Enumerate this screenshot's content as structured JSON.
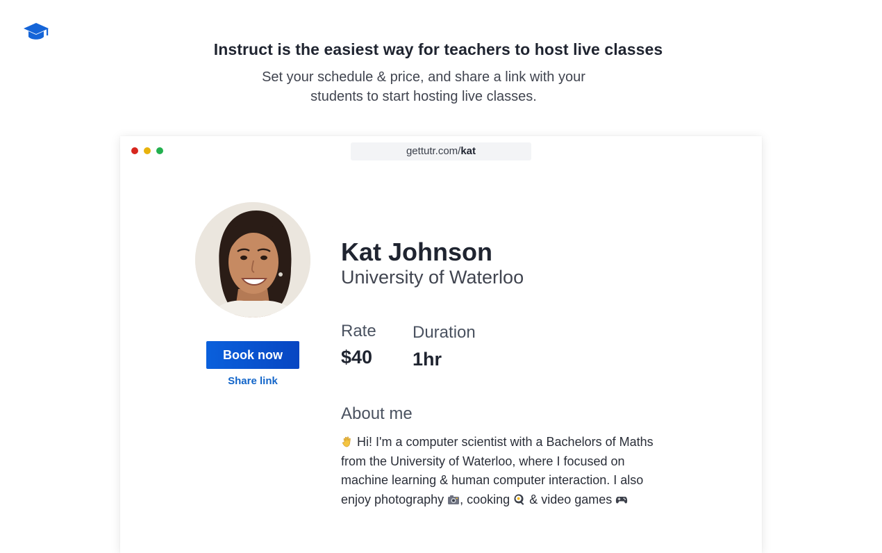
{
  "logo": {
    "icon": "graduation-cap-icon",
    "color": "#1565d8"
  },
  "hero": {
    "title": "Instruct is the easiest way for teachers to host live classes",
    "subtitle_line1": "Set your schedule & price, and share a link with your",
    "subtitle_line2": "students to start hosting live classes."
  },
  "browser": {
    "url_domain": "gettutr.com/",
    "url_path": "kat",
    "window_dots": [
      "#d7261e",
      "#e8b20c",
      "#23b04f"
    ]
  },
  "profile": {
    "name": "Kat Johnson",
    "school": "University of Waterloo",
    "book_label": "Book now",
    "share_label": "Share link",
    "rate_label": "Rate",
    "rate_value": "$40",
    "duration_label": "Duration",
    "duration_value": "1hr",
    "about_title": "About me",
    "about_line1": "Hi! I'm a computer scientist with a Bachelors of Maths",
    "about_line2": "from the University of Waterloo, where I focused on",
    "about_line3": "machine learning & human computer interaction. I also",
    "about_line4a": "enjoy photography",
    "about_line4b": ", cooking",
    "about_line4c": "& video games",
    "accent_color": "#0b5bd6"
  }
}
